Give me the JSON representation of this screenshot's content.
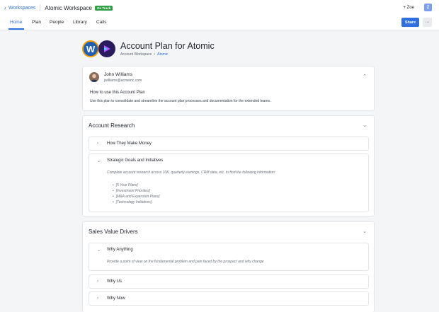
{
  "topbar": {
    "back_label": "Workspaces",
    "workspace_title": "Atomic Workspace",
    "status_badge": "On Track",
    "add_user_label": "+ Zoe",
    "avatar_initial": "Z"
  },
  "tabs": [
    "Home",
    "Plan",
    "People",
    "Library",
    "Calls"
  ],
  "active_tab": "Home",
  "actions": {
    "share_label": "Share",
    "more_label": "···"
  },
  "header": {
    "title": "Account Plan for Atomic",
    "breadcrumb_workspace": "Account Workspace",
    "breadcrumb_account": "Atomic",
    "logo_letter": "W"
  },
  "owner_card": {
    "name": "John Williams",
    "email": "jwilliams@acmeinc.com",
    "howto_title": "How to use this Account Plan",
    "howto_body": "Use this plan to consolidate and streamline the account plan processes and documentation for the extended teams."
  },
  "account_research": {
    "title": "Account Research",
    "items": [
      {
        "title": "How They Make Money"
      },
      {
        "title": "Strategic Goals and Initiatives",
        "description": "Complete account research across 10K, quarterly earnings, CRM data, etc. to find the following information:",
        "bullets": [
          "[5 Year Plans]",
          "[Investment Priorities]",
          "[M&A and Expansion Plans]",
          "[Technology Initiatives]"
        ]
      }
    ]
  },
  "sales_value_drivers": {
    "title": "Sales Value Drivers",
    "items": [
      {
        "title": "Why Anything",
        "description": "Provide a point of view on the fundamental problem and pain faced by the prospect and why change"
      },
      {
        "title": "Why Us"
      },
      {
        "title": "Why Now"
      }
    ]
  },
  "colors": {
    "accent": "#2f6fe0",
    "badge": "#2f9e44"
  },
  "icons": {
    "back": "chevron-left-icon",
    "collapse": "chevron-up-icon",
    "expand": "chevron-right-icon",
    "expanded": "chevron-down-icon"
  }
}
